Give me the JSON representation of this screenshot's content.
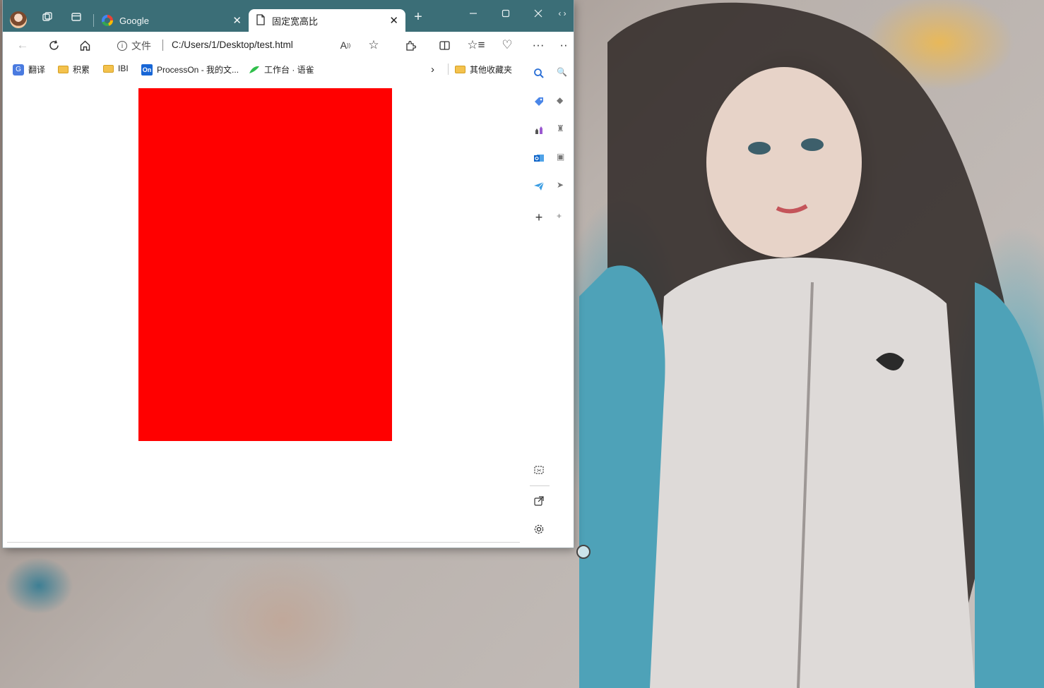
{
  "tabs": [
    {
      "title": "Google",
      "icon": "google-icon",
      "active": false
    },
    {
      "title": "固定宽高比",
      "icon": "page-icon",
      "active": true
    }
  ],
  "toolbar": {
    "address_info_label": "文件",
    "url": "C:/Users/1/Desktop/test.html"
  },
  "favorites": [
    {
      "label": "翻译",
      "icon": "translate-icon"
    },
    {
      "label": "积累",
      "icon": "folder-icon"
    },
    {
      "label": "IBI",
      "icon": "folder-icon"
    },
    {
      "label": "ProcessOn - 我的文...",
      "icon": "processon-icon"
    },
    {
      "label": "工作台 · 语雀",
      "icon": "yuque-icon"
    },
    {
      "label": "其他收藏夹",
      "icon": "folder-icon"
    }
  ],
  "content": {
    "box_color": "#ff0000"
  },
  "colors": {
    "tab_strip": "#3b6e77",
    "active_tab": "#ffffff"
  }
}
